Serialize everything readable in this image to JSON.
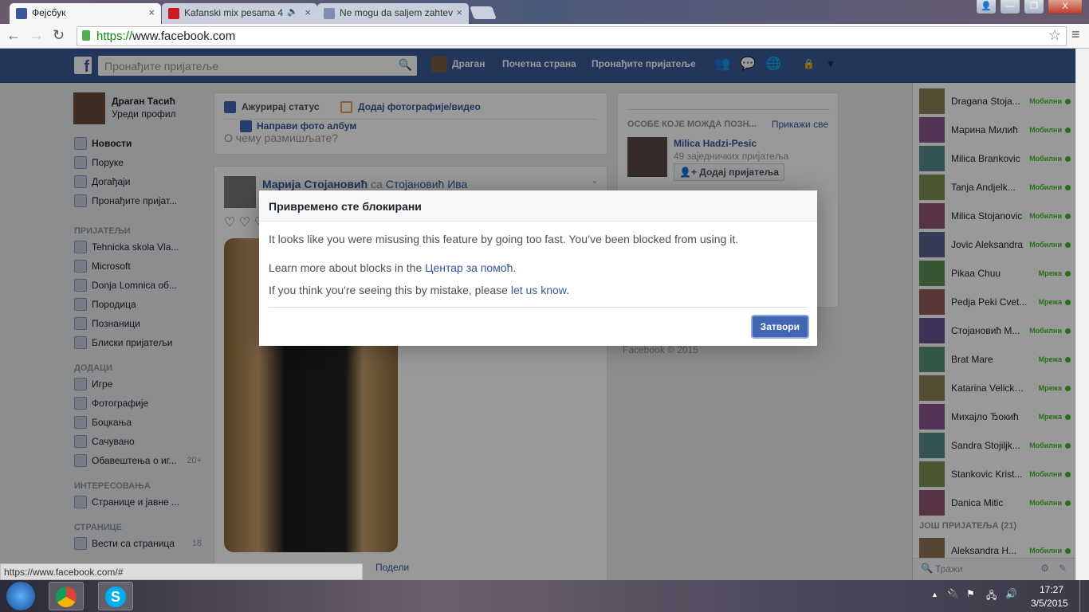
{
  "browser": {
    "tabs": [
      {
        "title": "Фејсбук",
        "active": true,
        "favicon_color": "#3b5998"
      },
      {
        "title": "Kafanski mix pesama 4",
        "active": false,
        "favicon_color": "#cc181e",
        "audio": true
      },
      {
        "title": "Ne mogu da saljem zahtev",
        "active": false,
        "favicon_color": "#7d8fb0"
      }
    ],
    "url_scheme": "https://",
    "url_host": "www.facebook.com",
    "status_url": "https://www.facebook.com/#"
  },
  "fb_header": {
    "search_placeholder": "Пронађите пријатеље",
    "user": "Драган",
    "home": "Почетна страна",
    "find_friends": "Пронађите пријатеље"
  },
  "left_nav": {
    "profile_name": "Драган Тасић",
    "edit_profile": "Уреди профил",
    "main": [
      {
        "label": "Новости",
        "bold": true
      },
      {
        "label": "Поруке"
      },
      {
        "label": "Догађаји"
      },
      {
        "label": "Пронађите пријат..."
      }
    ],
    "sections": [
      {
        "title": "ПРИЈАТЕЉИ",
        "items": [
          {
            "label": "Tehnicka skola Vla..."
          },
          {
            "label": "Microsoft"
          },
          {
            "label": "Donja Lomnica об..."
          },
          {
            "label": "Породица"
          },
          {
            "label": "Познаници"
          },
          {
            "label": "Блиски пријатељи"
          }
        ]
      },
      {
        "title": "ДОДАЦИ",
        "items": [
          {
            "label": "Игре"
          },
          {
            "label": "Фотографије"
          },
          {
            "label": "Боцкања"
          },
          {
            "label": "Сачувано"
          },
          {
            "label": "Обавештења о иг...",
            "count": "20+"
          }
        ]
      },
      {
        "title": "ИНТЕРЕСОВАЊА",
        "items": [
          {
            "label": "Странице и јавне ..."
          }
        ]
      },
      {
        "title": "СТРАНИЦЕ",
        "items": [
          {
            "label": "Вести са страница",
            "count": "18"
          }
        ]
      }
    ]
  },
  "composer": {
    "update_status": "Ажурирај статус",
    "add_photo": "Додај фотографије/видео",
    "create_album": "Направи фото албум",
    "placeholder": "О чему размишљате?"
  },
  "post": {
    "author": "Марија Стојановић",
    "with_word": "са",
    "tagged": "Стојановић Ива",
    "hearts": "♡ ♡ ♡",
    "share": "Подели"
  },
  "suggestions": {
    "title": "ОСОБЕ КОЈЕ МОЖДА ПОЗН...",
    "see_all": "Прикажи све",
    "name": "Milica Hadzi-Pesic",
    "mutual": "49 заједничких пријатеља",
    "add_button": "Додај пријатеља",
    "footer": "Facebook © 2015"
  },
  "chat": {
    "friends": [
      {
        "name": "Dragana Stoja...",
        "status": "Мобилни"
      },
      {
        "name": "Марина Милић",
        "status": "Мобилни"
      },
      {
        "name": "Milica Brankovic",
        "status": "Мобилни"
      },
      {
        "name": "Tanja Andjelk...",
        "status": "Мобилни"
      },
      {
        "name": "Milica Stojanovic",
        "status": "Мобилни"
      },
      {
        "name": "Jovic Aleksandra",
        "status": "Мобилни"
      },
      {
        "name": "Pikaa Chuu",
        "status": "Мрежа"
      },
      {
        "name": "Pedja Peki Cvet...",
        "status": "Мрежа"
      },
      {
        "name": "Стојановић М...",
        "status": "Мобилни"
      },
      {
        "name": "Brat Mare",
        "status": "Мрежа"
      },
      {
        "name": "Katarina Velicko...",
        "status": "Мрежа"
      },
      {
        "name": "Михајло Ђокић",
        "status": "Мрежа"
      },
      {
        "name": "Sandra Stojiljk...",
        "status": "Мобилни"
      },
      {
        "name": "Stankovic Krist...",
        "status": "Мобилни"
      },
      {
        "name": "Danica Mitic",
        "status": "Мобилни"
      }
    ],
    "more_title": "ЈОШ ПРИЈАТЕЉА (21)",
    "more": [
      {
        "name": "Aleksandra H...",
        "status": "Мобилни"
      }
    ],
    "search_placeholder": "Тражи",
    "online_color": "#42b72a"
  },
  "modal": {
    "title": "Привремено сте блокирани",
    "p1": "It looks like you were misusing this feature by going too fast. You’ve been blocked from using it.",
    "p2_pre": "Learn more about blocks in the ",
    "p2_link": "Центар за помоћ",
    "p2_post": ".",
    "p3_pre": "If you think you're seeing this by mistake, please ",
    "p3_link": "let us know",
    "p3_post": ".",
    "close": "Затвори"
  },
  "taskbar": {
    "time": "17:27",
    "date": "3/5/2015"
  },
  "colors": {
    "fb_blue": "#3b5998",
    "link": "#365899",
    "button": "#4267b2"
  }
}
